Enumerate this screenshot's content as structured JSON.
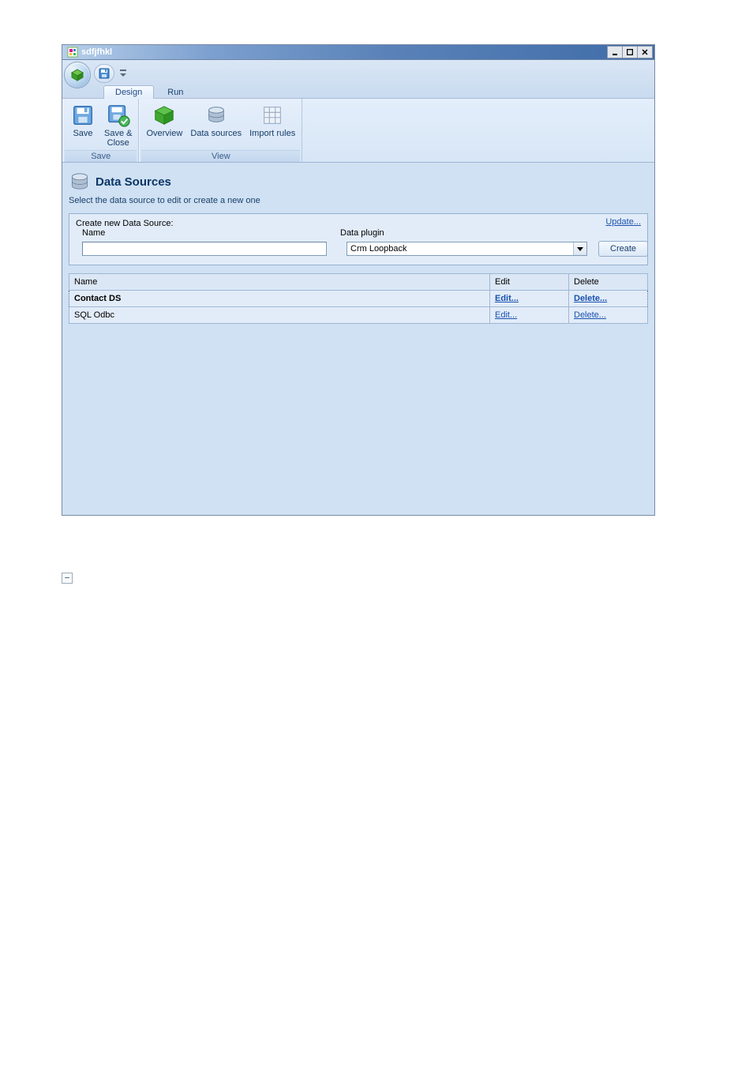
{
  "window": {
    "title": "sdfjfhkl"
  },
  "tabs": {
    "design": "Design",
    "run": "Run"
  },
  "ribbon": {
    "group_save_title": "Save",
    "group_view_title": "View",
    "save": "Save",
    "save_close": "Save &\nClose",
    "overview": "Overview",
    "data_sources": "Data sources",
    "import_rules": "Import rules"
  },
  "panel": {
    "title": "Data Sources",
    "subtitle": "Select the data source to edit or create a new one"
  },
  "create": {
    "header": "Create new Data Source:",
    "name_label": "Name",
    "plugin_label": "Data plugin",
    "name_value": "",
    "plugin_value": "Crm Loopback",
    "update_link": "Update...",
    "create_button": "Create"
  },
  "table": {
    "headers": {
      "name": "Name",
      "edit": "Edit",
      "delete": "Delete"
    },
    "rows": [
      {
        "name": "Contact DS",
        "edit": "Edit...",
        "delete": "Delete...",
        "selected": true
      },
      {
        "name": "SQL Odbc",
        "edit": "Edit...",
        "delete": "Delete...",
        "selected": false
      }
    ]
  },
  "collapse_glyph": "−"
}
